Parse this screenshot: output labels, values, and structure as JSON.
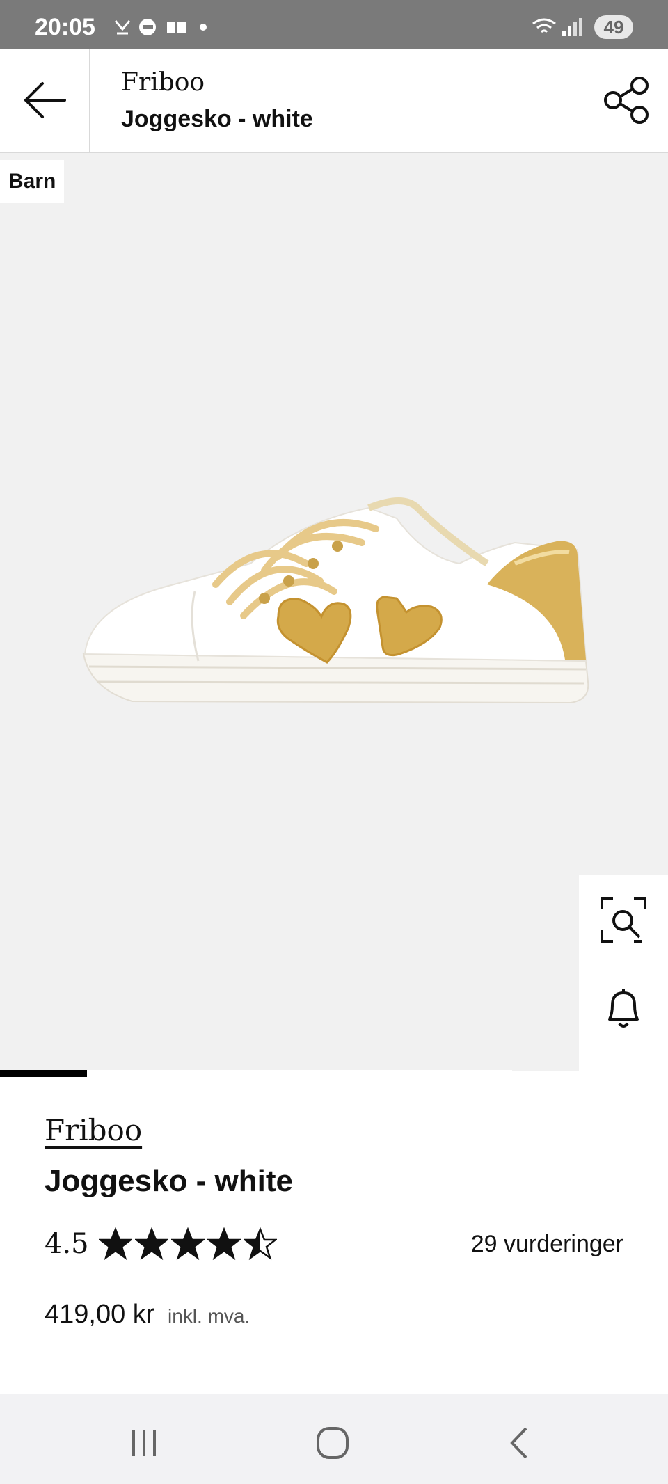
{
  "status_bar": {
    "time": "20:05",
    "battery": "49"
  },
  "header": {
    "brand": "Friboo",
    "title": "Joggesko - white"
  },
  "image_area": {
    "badge": "Barn",
    "carousel_progress": 0.17
  },
  "side_actions": {
    "icons": [
      "visual-search-icon",
      "bell-icon",
      "heart-icon",
      "shopping-bag-icon"
    ]
  },
  "product": {
    "brand": "Friboo",
    "name": "Joggesko - white",
    "rating": "4.5",
    "stars": 4.5,
    "reviews": "29 vurderinger",
    "price": "419,00 kr",
    "vat_note": "inkl. mva."
  },
  "colors": {
    "status_bar": "#7a7a7a",
    "image_bg": "#f1f1f1",
    "shoe_gold": "#d4a94a"
  }
}
